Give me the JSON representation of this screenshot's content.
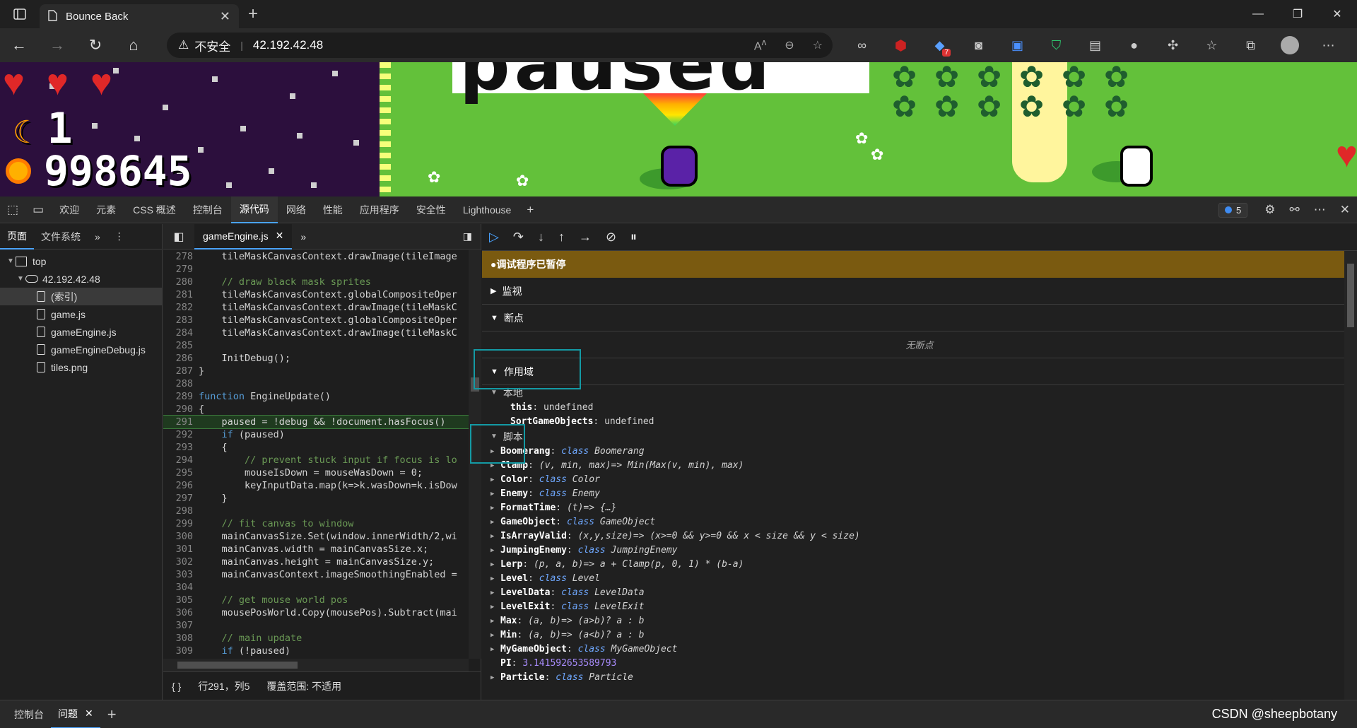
{
  "browser": {
    "tab_title": "Bounce Back",
    "security_label": "不安全",
    "url": "42.192.42.48",
    "ext_badge": "7"
  },
  "game": {
    "lives": "1",
    "score": "998645",
    "banner_text": "paused"
  },
  "devtools": {
    "tabs": [
      "欢迎",
      "元素",
      "CSS 概述",
      "控制台",
      "源代码",
      "网络",
      "性能",
      "应用程序",
      "安全性",
      "Lighthouse"
    ],
    "active_tab": "源代码",
    "issue_count": "5",
    "left_tabs": [
      "页面",
      "文件系统"
    ],
    "tree": {
      "top": "top",
      "host": "42.192.42.48",
      "files": [
        "(索引)",
        "game.js",
        "gameEngine.js",
        "gameEngineDebug.js",
        "tiles.png"
      ]
    },
    "editor_tab": "gameEngine.js",
    "status_bar": {
      "braces": "{ }",
      "position": "行291，列5",
      "coverage": "覆盖范围: 不适用"
    },
    "debugger": {
      "paused_msg": "调试程序已暂停",
      "watch": "监视",
      "breakpoints": "断点",
      "no_breakpoints": "无断点",
      "scope": "作用域",
      "local_label": "本地",
      "script_label": "脚本"
    },
    "drawer_tabs": [
      "控制台",
      "问题"
    ]
  },
  "code_lines": [
    {
      "n": "278",
      "t": "    tileMaskCanvasContext.drawImage(tileImage"
    },
    {
      "n": "279",
      "t": ""
    },
    {
      "n": "280",
      "t": "    // draw black mask sprites"
    },
    {
      "n": "281",
      "t": "    tileMaskCanvasContext.globalCompositeOper"
    },
    {
      "n": "282",
      "t": "    tileMaskCanvasContext.drawImage(tileMaskC"
    },
    {
      "n": "283",
      "t": "    tileMaskCanvasContext.globalCompositeOper"
    },
    {
      "n": "284",
      "t": "    tileMaskCanvasContext.drawImage(tileMaskC"
    },
    {
      "n": "285",
      "t": ""
    },
    {
      "n": "286",
      "t": "    InitDebug();"
    },
    {
      "n": "287",
      "t": "}"
    },
    {
      "n": "288",
      "t": ""
    },
    {
      "n": "289",
      "t": "function EngineUpdate()"
    },
    {
      "n": "290",
      "t": "{"
    },
    {
      "n": "291",
      "t": "    paused = !debug && !document.hasFocus()"
    },
    {
      "n": "292",
      "t": "    if (paused)"
    },
    {
      "n": "293",
      "t": "    {"
    },
    {
      "n": "294",
      "t": "        // prevent stuck input if focus is lo"
    },
    {
      "n": "295",
      "t": "        mouseIsDown = mouseWasDown = 0;"
    },
    {
      "n": "296",
      "t": "        keyInputData.map(k=>k.wasDown=k.isDow"
    },
    {
      "n": "297",
      "t": "    }"
    },
    {
      "n": "298",
      "t": ""
    },
    {
      "n": "299",
      "t": "    // fit canvas to window"
    },
    {
      "n": "300",
      "t": "    mainCanvasSize.Set(window.innerWidth/2,wi"
    },
    {
      "n": "301",
      "t": "    mainCanvas.width = mainCanvasSize.x;"
    },
    {
      "n": "302",
      "t": "    mainCanvas.height = mainCanvasSize.y;"
    },
    {
      "n": "303",
      "t": "    mainCanvasContext.imageSmoothingEnabled ="
    },
    {
      "n": "304",
      "t": ""
    },
    {
      "n": "305",
      "t": "    // get mouse world pos"
    },
    {
      "n": "306",
      "t": "    mousePosWorld.Copy(mousePos).Subtract(mai"
    },
    {
      "n": "307",
      "t": ""
    },
    {
      "n": "308",
      "t": "    // main update"
    },
    {
      "n": "309",
      "t": "    if (!paused)"
    },
    {
      "n": "310",
      "t": "    {"
    }
  ],
  "local_props": [
    {
      "key": "this",
      "val": "undefined"
    },
    {
      "key": "SortGameObjects",
      "val": "undefined"
    }
  ],
  "script_props": [
    {
      "key": "Boomerang",
      "kw": "class",
      "val": "Boomerang"
    },
    {
      "key": "Clamp",
      "kw": "",
      "val": "(v, min, max)=> Min(Max(v, min), max)"
    },
    {
      "key": "Color",
      "kw": "class",
      "val": "Color"
    },
    {
      "key": "Enemy",
      "kw": "class",
      "val": "Enemy"
    },
    {
      "key": "FormatTime",
      "kw": "",
      "val": "(t)=> {…}"
    },
    {
      "key": "GameObject",
      "kw": "class",
      "val": "GameObject"
    },
    {
      "key": "IsArrayValid",
      "kw": "",
      "val": "(x,y,size)=> (x>=0 && y>=0 && x < size && y < size)"
    },
    {
      "key": "JumpingEnemy",
      "kw": "class",
      "val": "JumpingEnemy"
    },
    {
      "key": "Lerp",
      "kw": "",
      "val": "(p, a, b)=> a + Clamp(p, 0, 1) * (b-a)"
    },
    {
      "key": "Level",
      "kw": "class",
      "val": "Level"
    },
    {
      "key": "LevelData",
      "kw": "class",
      "val": "LevelData"
    },
    {
      "key": "LevelExit",
      "kw": "class",
      "val": "LevelExit"
    },
    {
      "key": "Max",
      "kw": "",
      "val": "(a, b)=> (a>b)? a : b"
    },
    {
      "key": "Min",
      "kw": "",
      "val": "(a, b)=> (a<b)? a : b"
    },
    {
      "key": "MyGameObject",
      "kw": "class",
      "val": "MyGameObject"
    },
    {
      "key": "PI",
      "kw": "num",
      "val": "3.141592653589793"
    },
    {
      "key": "Particle",
      "kw": "class",
      "val": "Particle"
    }
  ],
  "watermark": "CSDN @sheepbotany"
}
